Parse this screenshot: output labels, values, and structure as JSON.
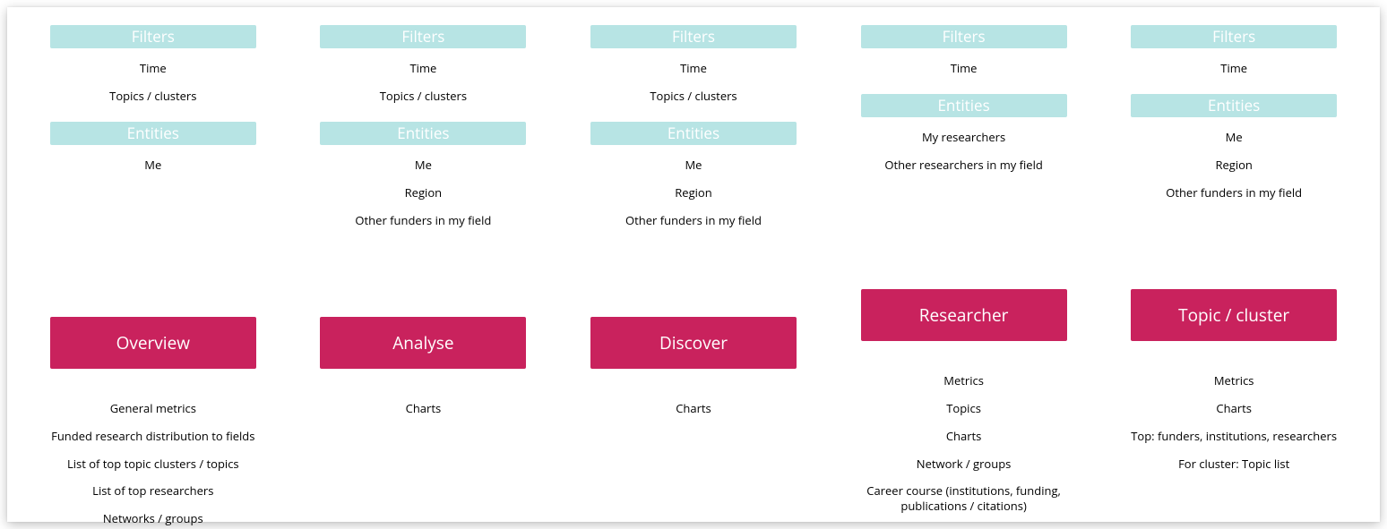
{
  "labels": {
    "filters": "Filters",
    "entities": "Entities"
  },
  "columns": [
    {
      "filters": [
        "Time",
        "Topics / clusters"
      ],
      "entities": [
        "Me"
      ],
      "button": "Overview",
      "contents": [
        "General metrics",
        "Funded research distribution to fields",
        "List of top topic clusters / topics",
        "List of top researchers",
        "Networks / groups"
      ]
    },
    {
      "filters": [
        "Time",
        "Topics / clusters"
      ],
      "entities": [
        "Me",
        "Region",
        "Other funders in my field"
      ],
      "button": "Analyse",
      "contents": [
        "Charts"
      ]
    },
    {
      "filters": [
        "Time",
        "Topics / clusters"
      ],
      "entities": [
        "Me",
        "Region",
        "Other funders in my field"
      ],
      "button": "Discover",
      "contents": [
        "Charts"
      ]
    },
    {
      "filters": [
        "Time"
      ],
      "entities": [
        "My researchers",
        "Other researchers in my field"
      ],
      "button": "Researcher",
      "contents": [
        "Metrics",
        "Topics",
        "Charts",
        "Network / groups",
        "Career course (institutions, funding, publications / citations)"
      ]
    },
    {
      "filters": [
        "Time"
      ],
      "entities": [
        "Me",
        "Region",
        "Other funders in my field"
      ],
      "button": "Topic / cluster",
      "contents": [
        "Metrics",
        "Charts",
        "Top: funders, institutions, researchers",
        "For cluster: Topic list"
      ]
    }
  ]
}
